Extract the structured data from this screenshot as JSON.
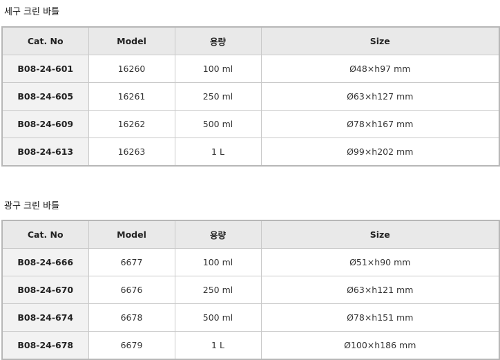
{
  "headers": {
    "cat_no": "Cat. No",
    "model": "Model",
    "capacity": "용량",
    "size": "Size"
  },
  "sections": [
    {
      "title": "세구 크린 바틀",
      "rows": [
        {
          "cat_no": "B08-24-601",
          "model": "16260",
          "capacity": "100 ml",
          "size": "Ø48×h97 mm"
        },
        {
          "cat_no": "B08-24-605",
          "model": "16261",
          "capacity": "250 ml",
          "size": "Ø63×h127 mm"
        },
        {
          "cat_no": "B08-24-609",
          "model": "16262",
          "capacity": "500 ml",
          "size": "Ø78×h167 mm"
        },
        {
          "cat_no": "B08-24-613",
          "model": "16263",
          "capacity": "1 L",
          "size": "Ø99×h202 mm"
        }
      ]
    },
    {
      "title": "광구 크린 바틀",
      "rows": [
        {
          "cat_no": "B08-24-666",
          "model": "6677",
          "capacity": "100 ml",
          "size": "Ø51×h90 mm"
        },
        {
          "cat_no": "B08-24-670",
          "model": "6676",
          "capacity": "250 ml",
          "size": "Ø63×h121 mm"
        },
        {
          "cat_no": "B08-24-674",
          "model": "6678",
          "capacity": "500 ml",
          "size": "Ø78×h151 mm"
        },
        {
          "cat_no": "B08-24-678",
          "model": "6679",
          "capacity": "1 L",
          "size": "Ø100×h186 mm"
        }
      ]
    }
  ]
}
